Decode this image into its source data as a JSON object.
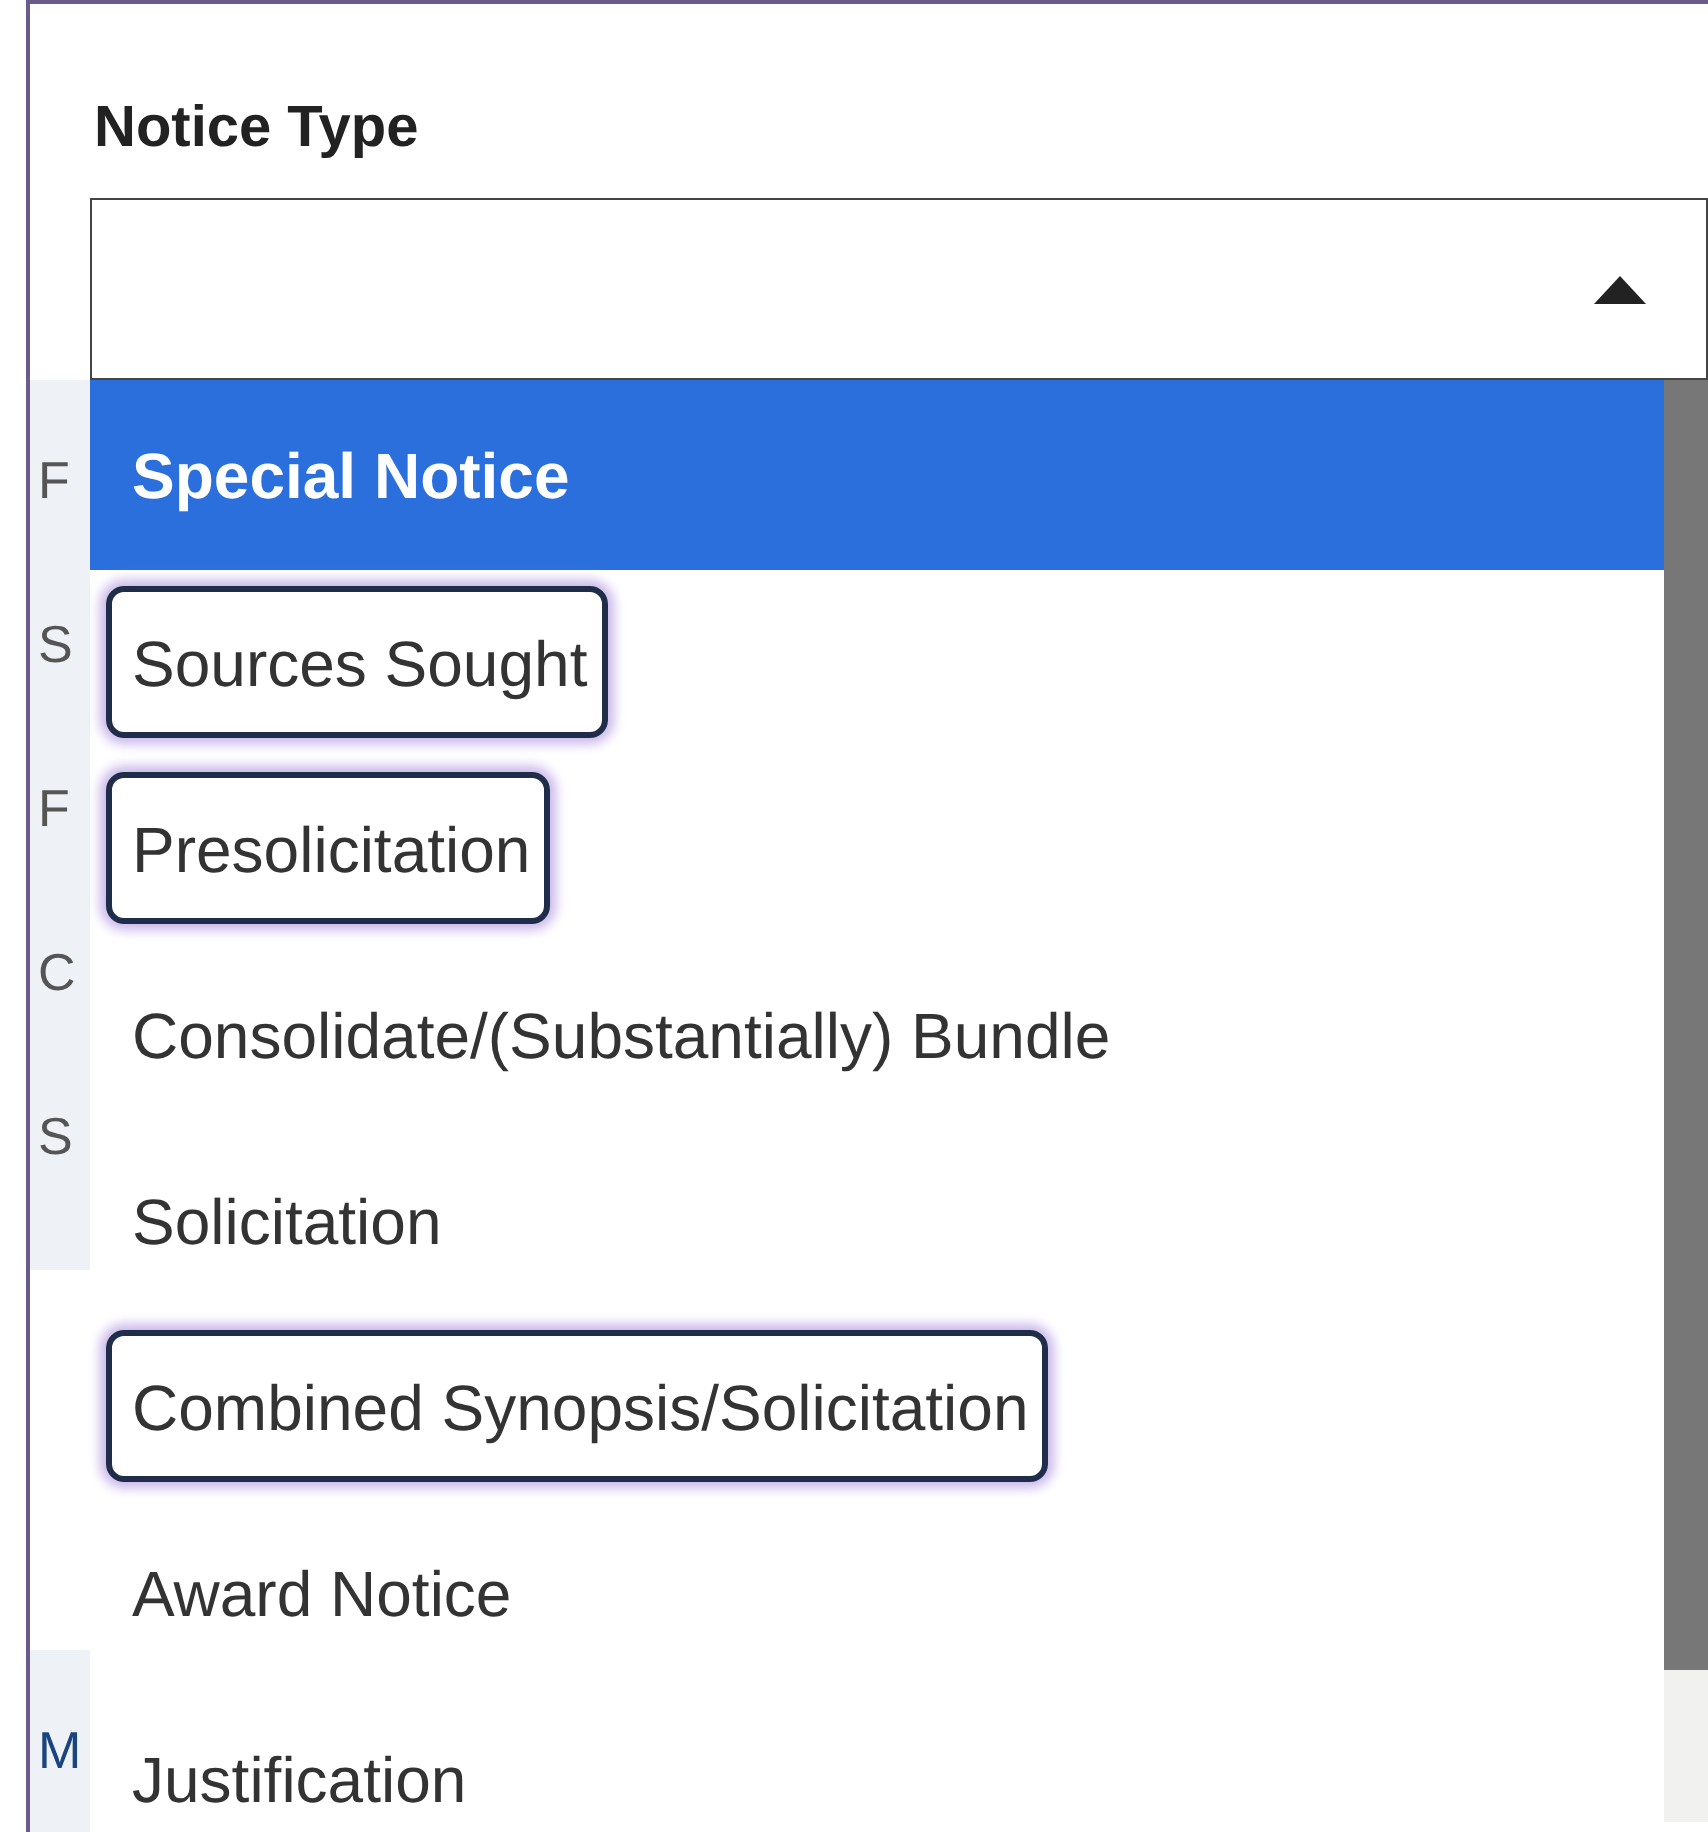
{
  "field": {
    "label": "Notice Type",
    "expanded": true
  },
  "options": [
    {
      "label": "Special Notice",
      "selected": true,
      "highlighted": false
    },
    {
      "label": "Sources Sought",
      "selected": false,
      "highlighted": true
    },
    {
      "label": "Presolicitation",
      "selected": false,
      "highlighted": true
    },
    {
      "label": "Consolidate/(Substantially) Bundle",
      "selected": false,
      "highlighted": false
    },
    {
      "label": "Solicitation",
      "selected": false,
      "highlighted": false
    },
    {
      "label": "Combined Synopsis/Solicitation",
      "selected": false,
      "highlighted": true
    },
    {
      "label": "Award Notice",
      "selected": false,
      "highlighted": false
    },
    {
      "label": "Justification",
      "selected": false,
      "highlighted": false
    }
  ],
  "background_fragments": [
    {
      "text": "F",
      "kind": "text"
    },
    {
      "text": "S",
      "kind": "text"
    },
    {
      "text": "F",
      "kind": "text"
    },
    {
      "text": "C",
      "kind": "text"
    },
    {
      "text": "S",
      "kind": "text"
    },
    {
      "text": "M",
      "kind": "link"
    }
  ]
}
